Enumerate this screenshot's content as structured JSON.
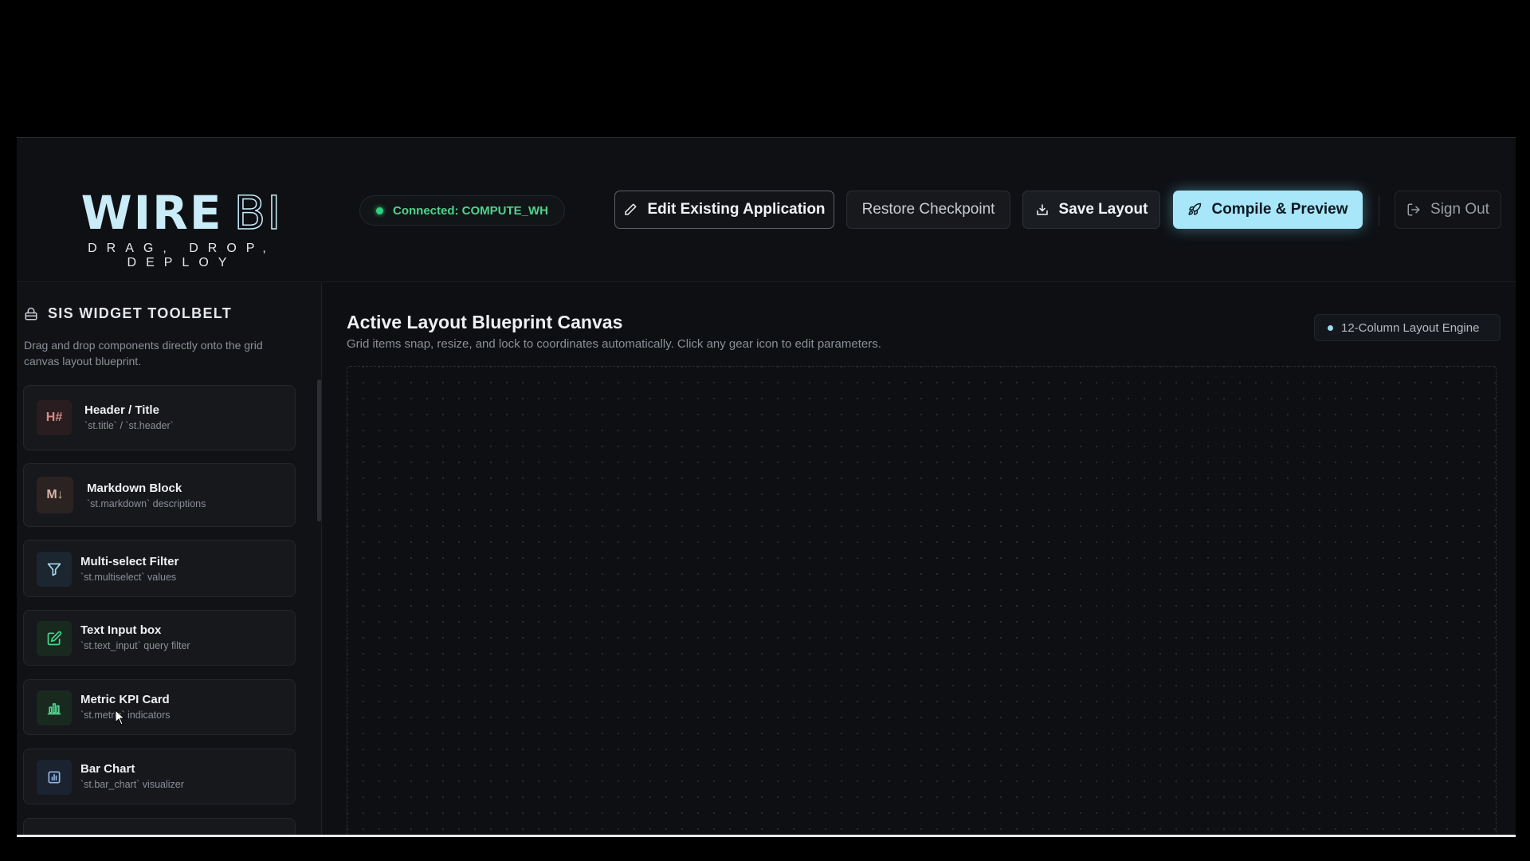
{
  "header": {
    "logo_main": "WIRE",
    "logo_bi": "BI",
    "logo_tagline": "DRAG, DROP, DEPLOY",
    "connection_status": "Connected: COMPUTE_WH",
    "edit_label": "Edit Existing Application",
    "restore_label": "Restore Checkpoint",
    "save_label": "Save Layout",
    "compile_label": "Compile & Preview",
    "signout_label": "Sign Out"
  },
  "sidebar": {
    "title": "SIS WIDGET TOOLBELT",
    "description": "Drag and drop components directly onto the grid canvas layout blueprint.",
    "widgets": [
      {
        "name": "Header / Title",
        "sub": "`st.title` / `st.header`",
        "icon": "H#"
      },
      {
        "name": "Markdown Block",
        "sub": "`st.markdown` descriptions",
        "icon": "M↓"
      },
      {
        "name": "Multi-select Filter",
        "sub": "`st.multiselect` values",
        "icon": "filter-icon"
      },
      {
        "name": "Text Input box",
        "sub": "`st.text_input` query filter",
        "icon": "edit-icon"
      },
      {
        "name": "Metric KPI Card",
        "sub": "`st.metric` indicators",
        "icon": "bar-chart-icon"
      },
      {
        "name": "Bar Chart",
        "sub": "`st.bar_chart` visualizer",
        "icon": "chart-box-icon"
      }
    ]
  },
  "main": {
    "title": "Active Layout Blueprint Canvas",
    "subtitle": "Grid items snap, resize, and lock to coordinates automatically. Click any gear icon to edit parameters.",
    "engine_label": "12-Column Layout Engine"
  },
  "colors": {
    "accent": "#a8e6f9",
    "connected": "#4fd38c",
    "background": "#0d0f12"
  }
}
